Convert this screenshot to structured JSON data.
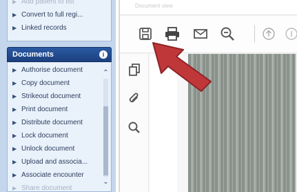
{
  "left_panel": {
    "top_items": [
      {
        "label": "Add patient to list"
      },
      {
        "label": "Convert to full regi..."
      },
      {
        "label": "Linked records"
      }
    ],
    "documents": {
      "header": "Documents",
      "badge": "i",
      "items": [
        {
          "label": "Authorise document"
        },
        {
          "label": "Copy document"
        },
        {
          "label": "Strikeout document"
        },
        {
          "label": "Print document"
        },
        {
          "label": "Distribute document"
        },
        {
          "label": "Lock document"
        },
        {
          "label": "Unlock document"
        },
        {
          "label": "Upload and associa..."
        },
        {
          "label": "Associate encounter"
        },
        {
          "label": "Share document"
        }
      ]
    }
  },
  "viewer": {
    "title": "Document view",
    "toolbar_icons": [
      "save-icon",
      "print-icon",
      "email-icon",
      "zoom-out-icon",
      "page-up-icon",
      "page-down-icon"
    ],
    "side_icons": [
      "copy-icon",
      "attachment-icon",
      "search-icon"
    ]
  },
  "colors": {
    "panel_header": "#1c407e",
    "panel_bg": "#e9f1fb",
    "arrow": "#c0373a"
  }
}
